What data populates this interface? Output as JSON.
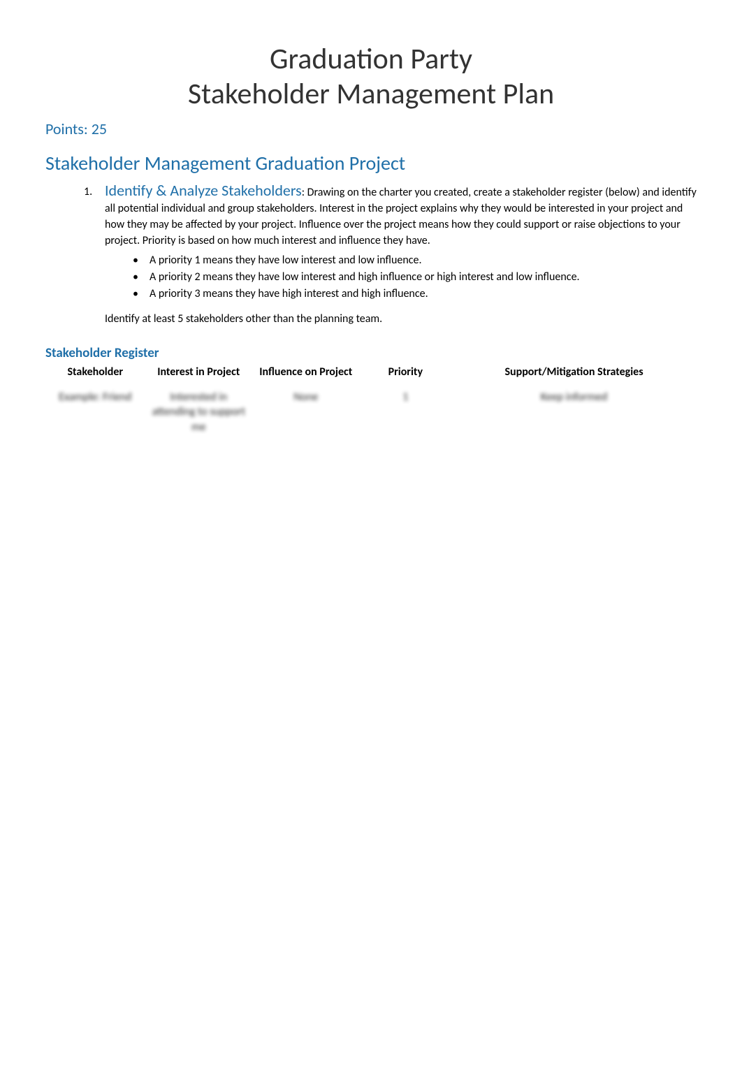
{
  "title_line1": "Graduation Party",
  "title_line2": "Stakeholder Management Plan",
  "points_label": "Points: 25",
  "section_heading": "Stakeholder Management Graduation Project",
  "item1": {
    "number": "1.",
    "heading": "Identify & Analyze Stakeholders",
    "intro": ": Drawing on the charter you created, create a stakeholder register (below) and identify all potential individual and group stakeholders. Interest in the project explains why they would be interested in your project and how they may be affected by your project. Influence over the project means how they could support or raise objections to your project. Priority is based on how much interest and influence they have.",
    "bullets": [
      "A priority 1 means they have low interest and low influence.",
      "A priority 2 means they have low interest and high influence or high interest and low influence.",
      "A priority 3 means they have high interest and high influence."
    ],
    "closing": "Identify at least 5 stakeholders other than the planning team."
  },
  "register": {
    "heading": "Stakeholder Register",
    "headers": {
      "stakeholder": "Stakeholder",
      "interest": "Interest in Project",
      "influence": "Influence on Project",
      "priority": "Priority",
      "support": "Support/Mitigation Strategies"
    },
    "rows": [
      {
        "stakeholder": "Example: Friend",
        "interest": "Interested in attending to support me",
        "influence": "None",
        "priority": "1",
        "support": "Keep informed"
      }
    ]
  }
}
